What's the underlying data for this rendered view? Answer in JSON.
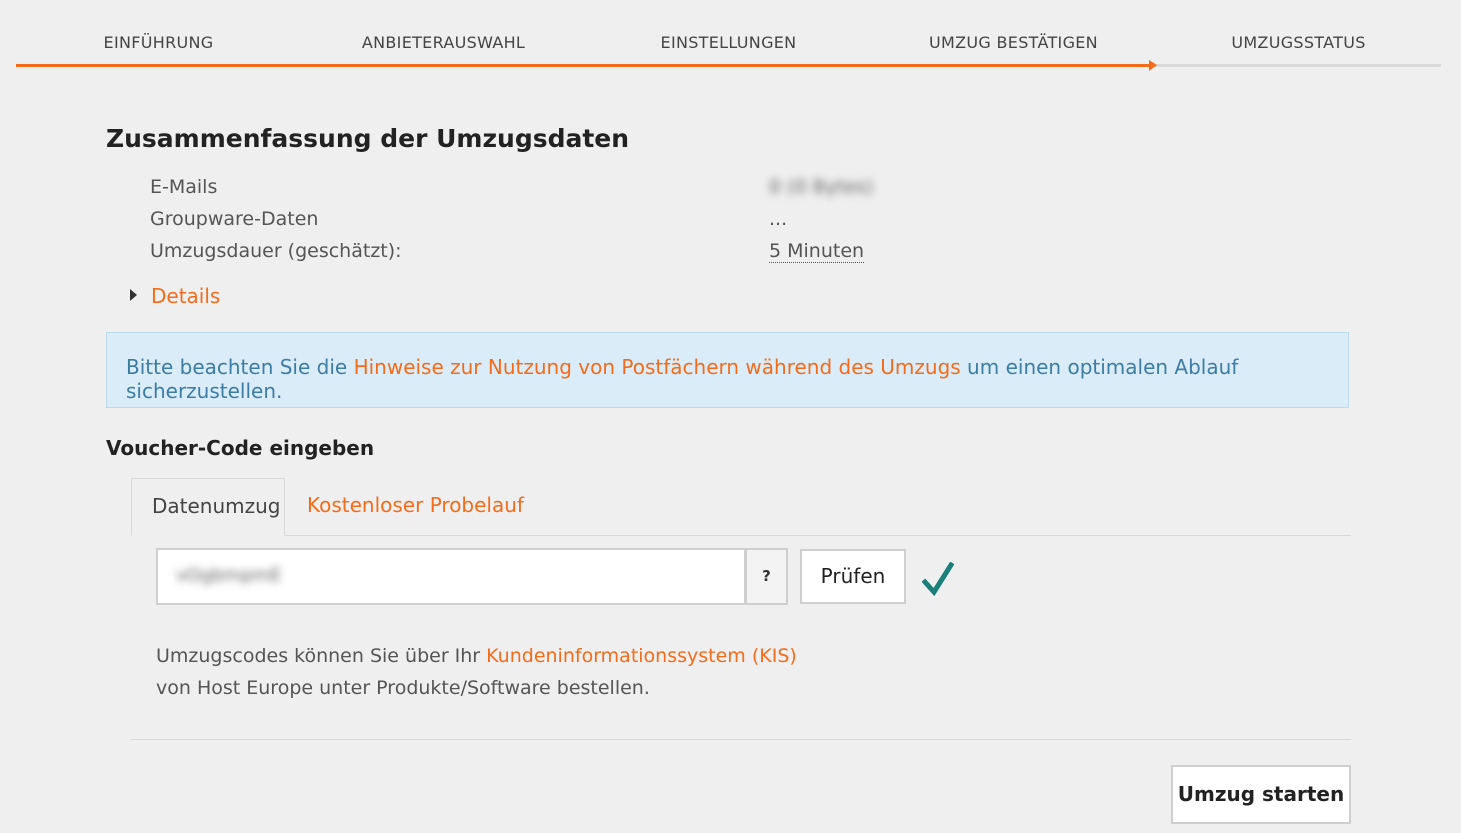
{
  "steps": [
    {
      "label": "Einführung"
    },
    {
      "label": "Anbieterauswahl"
    },
    {
      "label": "Einstellungen"
    },
    {
      "label": "Umzug bestätigen"
    },
    {
      "label": "Umzugsstatus"
    }
  ],
  "summary": {
    "title": "Zusammenfassung der Umzugsdaten",
    "rows": [
      {
        "label": "E-Mails",
        "value": "0 (0 Bytes)"
      },
      {
        "label": "Groupware-Daten",
        "value": "..."
      },
      {
        "label": "Umzugsdauer (geschätzt):",
        "value": "5 Minuten"
      }
    ],
    "details_label": "Details"
  },
  "notice": {
    "prefix": "Bitte beachten Sie die ",
    "link": "Hinweise zur Nutzung von Postfächern während des Umzugs",
    "suffix": " um einen optimalen Ablauf sicherzustellen."
  },
  "voucher": {
    "title": "Voucher-Code eingeben",
    "tabs": [
      {
        "label": "Datenumzug"
      },
      {
        "label": "Kostenloser Probelauf"
      }
    ],
    "input_value": "vOgbmpmE",
    "help_label": "?",
    "check_label": "Prüfen",
    "info_prefix": "Umzugscodes können Sie über Ihr ",
    "info_link": "Kundeninformationssystem (KIS)",
    "info_suffix": "von Host Europe unter Produkte/Software bestellen."
  },
  "start_label": "Umzug starten",
  "colors": {
    "accent": "#f36c1b",
    "notice_bg": "#d9ecf7",
    "check": "#1b7f7a"
  }
}
